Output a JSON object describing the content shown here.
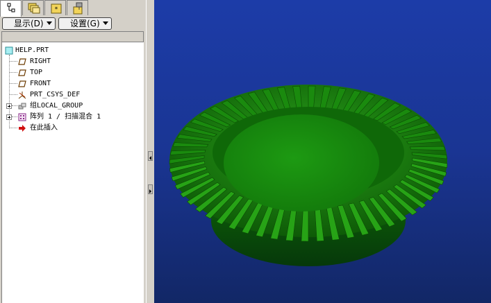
{
  "toolbar": {
    "show_label": "显示(D)",
    "settings_label": "设置(G)"
  },
  "tabs": [
    {
      "name": "model-tree-tab",
      "icon": "tree-icon"
    },
    {
      "name": "folder-browser-tab",
      "icon": "folders-icon"
    },
    {
      "name": "favorites-tab",
      "icon": "favorites-icon"
    },
    {
      "name": "connections-tab",
      "icon": "connections-icon"
    }
  ],
  "tree": {
    "root": "HELP.PRT",
    "items": [
      {
        "label": "RIGHT",
        "icon": "datum-plane-icon"
      },
      {
        "label": "TOP",
        "icon": "datum-plane-icon"
      },
      {
        "label": "FRONT",
        "icon": "datum-plane-icon"
      },
      {
        "label": "PRT_CSYS_DEF",
        "icon": "csys-icon"
      },
      {
        "label": "组LOCAL_GROUP",
        "icon": "group-icon"
      },
      {
        "label": "阵列 1 / 扫描混合 1",
        "icon": "pattern-icon"
      },
      {
        "label": "在此插入",
        "icon": "insert-here-arrow-icon"
      }
    ]
  },
  "colors": {
    "viewport_bg": "#1a3593",
    "gear_green": "#1f8a12",
    "gear_dark": "#0c4f05"
  },
  "viewport": {
    "model": "bevel-gear"
  }
}
